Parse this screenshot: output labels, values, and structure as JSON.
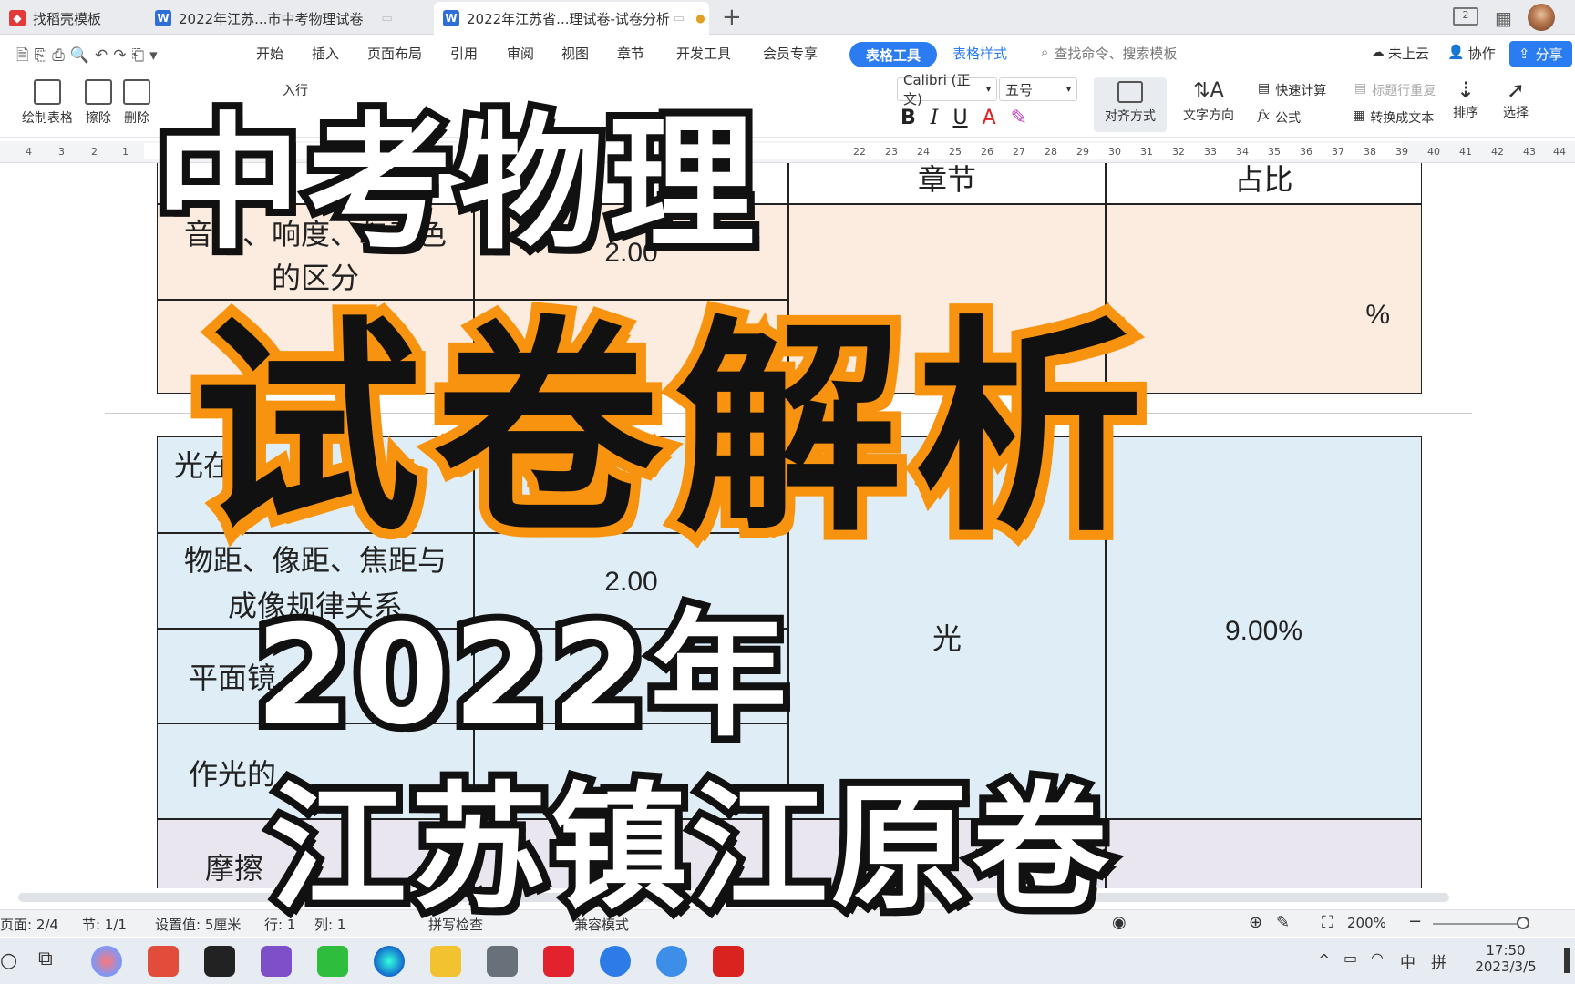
{
  "tabs": [
    {
      "label": "找稻壳模板",
      "icon": "docer-icon"
    },
    {
      "label": "2022年江苏...市中考物理试卷",
      "icon": "wps-writer-icon"
    },
    {
      "label": "2022年江苏省...理试卷-试卷分析",
      "icon": "wps-writer-icon"
    }
  ],
  "menu": [
    "开始",
    "插入",
    "页面布局",
    "引用",
    "审阅",
    "视图",
    "章节",
    "开发工具",
    "会员专享"
  ],
  "menu_active": "表格工具",
  "menu_secondary": "表格样式",
  "search_placeholder": "查找命令、搜索模板",
  "cloud_label": "未上云",
  "collab_label": "协作",
  "share_label": "分享",
  "ribbon": {
    "draw_table": "绘制表格",
    "erase": "擦除",
    "delete": "删除",
    "font_name": "Calibri (正文)",
    "font_size": "五号",
    "align": "对齐方式",
    "text_dir": "文字方向",
    "quick_calc": "快速计算",
    "header_repeat": "标题行重复",
    "formula": "公式",
    "to_text": "转换成文本",
    "sort": "排序",
    "select": "选择",
    "insert_row": "入行"
  },
  "ruler_left": [
    "4",
    "3",
    "2",
    "1"
  ],
  "ruler_right": [
    "22",
    "23",
    "24",
    "25",
    "26",
    "27",
    "28",
    "29",
    "30",
    "31",
    "32",
    "33",
    "34",
    "35",
    "36",
    "37",
    "38",
    "39",
    "40",
    "41",
    "42",
    "43",
    "44"
  ],
  "table": {
    "header_col3": "章节",
    "header_col4": "占比",
    "row1_col1_line1": "音调、响度、与音色",
    "row1_col1_line2": "的区分",
    "row1_col2": "2.00",
    "row1_col4": "%",
    "row3_col1": "光在",
    "row4_col1_line1": "物距、像距、焦距与",
    "row4_col1_line2": "成像规律关系",
    "row4_col2": "2.00",
    "light_chapter": "光",
    "light_pct": "9.00%",
    "row5_col1": "平面镜",
    "row6_col1": "作光的",
    "row7_col1": "摩擦"
  },
  "overlay": {
    "line1": "中考物理",
    "line2": "试卷解析",
    "line3": "2022年",
    "line4": "江苏镇江原卷"
  },
  "status": {
    "page": "页面: 2/4",
    "section": "节: 1/1",
    "setting": "设置值: 5厘米",
    "row": "行: 1",
    "col": "列: 1",
    "spell": "拼写检查",
    "compat": "兼容模式",
    "zoom": "200%"
  },
  "taskbar": {
    "time": "17:50",
    "date": "2023/3/5",
    "ime_lang": "中",
    "ime_mode": "拼"
  },
  "colors": {
    "accent": "#2b7cf0",
    "overlay_orange": "#f7930f",
    "peach_row": "#fcebdf",
    "blue_row": "#dfeef6"
  }
}
